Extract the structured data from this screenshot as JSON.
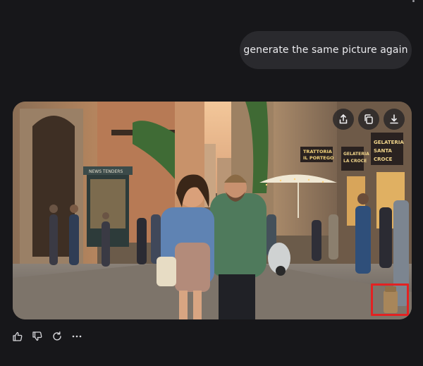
{
  "chat": {
    "user_message": "generate the same picture again"
  },
  "generated_image": {
    "signs": {
      "trattoria": "TRATTORIA IL PORTEGO",
      "gelateria_left": "GELATERIA LA CROCE",
      "gelateria_right": "GELATERIA SANTA CROCE",
      "news": "NEWS TENDERS"
    },
    "overlay_buttons": {
      "share_icon": "share-icon",
      "copy_icon": "copy-icon",
      "download_icon": "download-icon"
    }
  },
  "response_actions": [
    "thumbs-up-icon",
    "thumbs-down-icon",
    "regenerate-icon",
    "more-icon"
  ],
  "colors": {
    "background": "#17171a",
    "bubble": "#2a2a2e",
    "highlight": "#e32222"
  }
}
